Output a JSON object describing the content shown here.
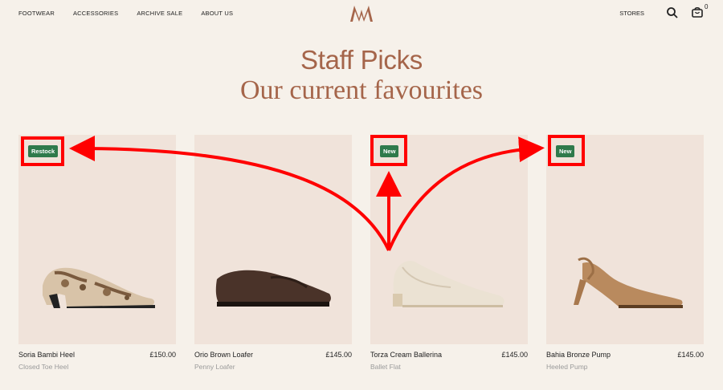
{
  "nav": {
    "left": [
      "FOOTWEAR",
      "ACCESSORIES",
      "ARCHIVE SALE",
      "ABOUT US"
    ],
    "stores": "STORES",
    "bag_count": "0"
  },
  "headings": {
    "title": "Staff Picks",
    "subtitle": "Our current favourites"
  },
  "products": [
    {
      "name": "Soria Bambi Heel",
      "price": "£150.00",
      "type": "Closed Toe Heel",
      "badge": "Restock"
    },
    {
      "name": "Orio Brown Loafer",
      "price": "£145.00",
      "type": "Penny Loafer",
      "badge": ""
    },
    {
      "name": "Torza Cream Ballerina",
      "price": "£145.00",
      "type": "Ballet Flat",
      "badge": "New"
    },
    {
      "name": "Bahia Bronze Pump",
      "price": "£145.00",
      "type": "Heeled Pump",
      "badge": "New"
    }
  ],
  "colors": {
    "brand": "#a5654a",
    "badge": "#2f7a4b",
    "annotation": "#ff0000",
    "background": "#f6f1ea"
  }
}
